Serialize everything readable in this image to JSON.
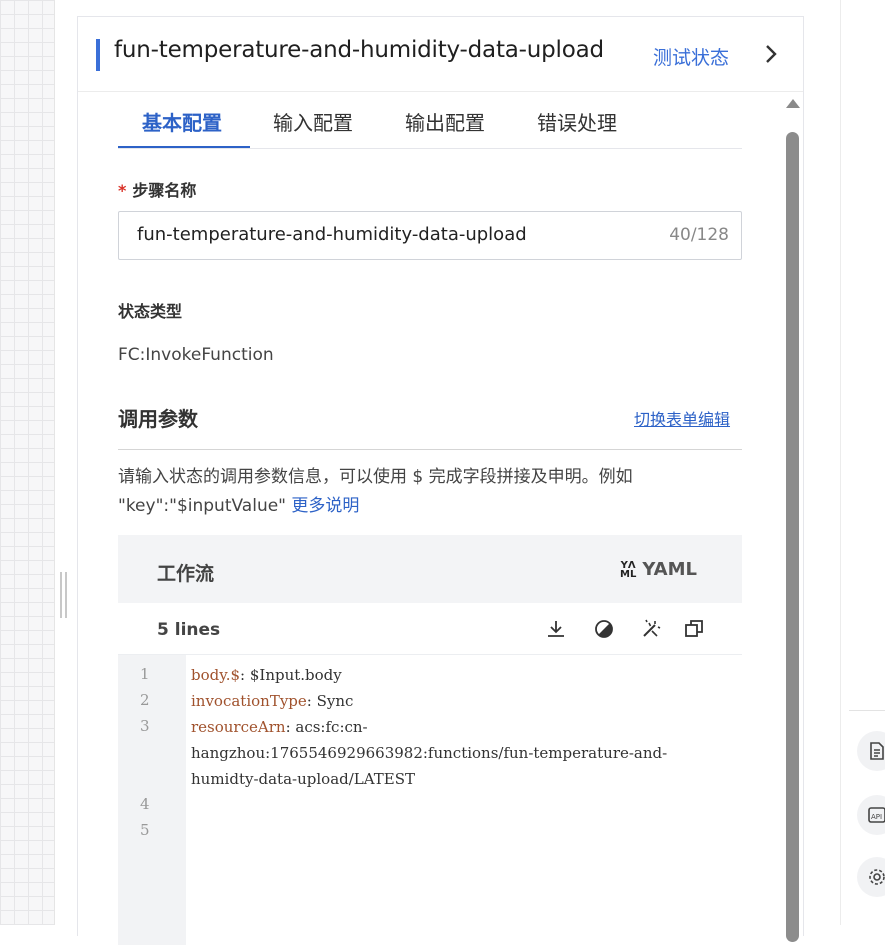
{
  "panel": {
    "title": "fun-temperature-and-humidity-data-upload",
    "test_state_label": "测试状态",
    "tabs": [
      {
        "label": "基本配置",
        "active": true
      },
      {
        "label": "输入配置",
        "active": false
      },
      {
        "label": "输出配置",
        "active": false
      },
      {
        "label": "错误处理",
        "active": false
      }
    ]
  },
  "form": {
    "required_mark": "*",
    "step_name_label": "步骤名称",
    "step_name_value": "fun-temperature-and-humidity-data-upload",
    "step_name_count": "40/128",
    "state_type_label": "状态类型",
    "state_type_value": "FC:InvokeFunction",
    "invoke_params_title": "调用参数",
    "switch_form_link": "切换表单编辑",
    "help_text": "请输入状态的调用参数信息，可以使用 $ 完成字段拼接及申明。例如 \"key\":\"$inputValue\"",
    "help_more_link": "更多说明"
  },
  "editor": {
    "title": "工作流",
    "format_label": "YAML",
    "lines_label": "5 lines",
    "line_numbers": [
      "1",
      "2",
      "3",
      "4",
      "5"
    ],
    "code": [
      {
        "key": "body.$",
        "sep": ": ",
        "value": "$Input.body"
      },
      {
        "key": "invocationType",
        "sep": ": ",
        "value": "Sync"
      },
      {
        "key": "resourceArn",
        "sep": ": ",
        "value": "acs:fc:cn-"
      },
      {
        "key": "",
        "sep": "",
        "value": "hangzhou:1765546929663982:functions/fun-temperature-and-"
      },
      {
        "key": "",
        "sep": "",
        "value": "humidty-data-upload/LATEST"
      }
    ]
  },
  "colors": {
    "accent": "#2d62c7",
    "yaml_key": "#a0522d",
    "required": "#d93026"
  }
}
